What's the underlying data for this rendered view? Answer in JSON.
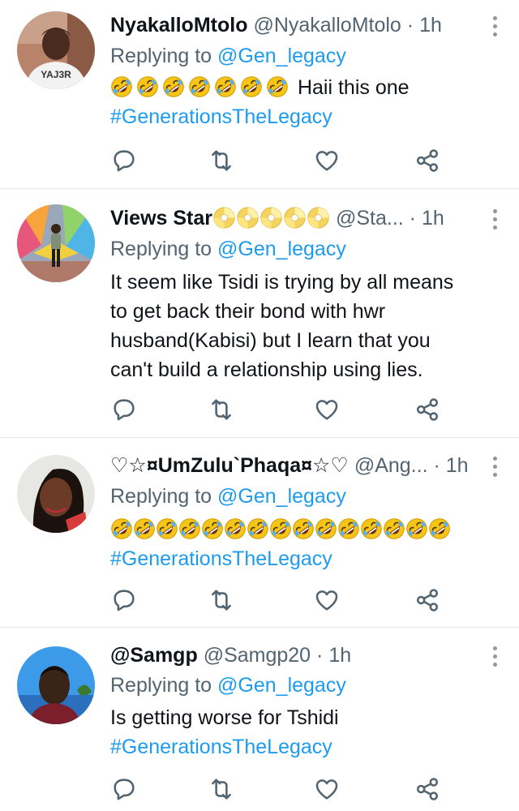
{
  "tweets": [
    {
      "name": "NyakalloMtolo",
      "handle": "@NyakalloMtolo",
      "dot": "·",
      "time": "1h",
      "replying_prefix": "Replying to",
      "replying_to": "@Gen_legacy",
      "text": "Haii this one",
      "hashtag": "#GenerationsTheLegacy",
      "emoji_count": 7,
      "avatar_shirt_text": "YAJ3R"
    },
    {
      "name": "Views Star",
      "handle": "@Sta...",
      "dot": "·",
      "time": "1h",
      "replying_prefix": "Replying to",
      "replying_to": "@Gen_legacy",
      "lines": [
        "It seem like Tsidi is trying by all means",
        "to get back their bond with hwr",
        "husband(Kabisi) but I learn that you",
        "can't build a relationship using lies."
      ],
      "name_emoji_count": 5
    },
    {
      "name": "♡☆¤UmZulu`Phaqa¤☆♡",
      "handle": "@Ang...",
      "dot": "·",
      "time": "1h",
      "replying_prefix": "Replying to",
      "replying_to": "@Gen_legacy",
      "hashtag": "#GenerationsTheLegacy",
      "emoji_count": 15
    },
    {
      "name": "@Samgp",
      "handle": "@Samgp20",
      "dot": "·",
      "time": "1h",
      "replying_prefix": "Replying to",
      "replying_to": "@Gen_legacy",
      "text": "Is getting worse for Tshidi",
      "hashtag": "#GenerationsTheLegacy"
    }
  ],
  "icons": {
    "reply": "reply-icon",
    "retweet": "retweet-icon",
    "like": "heart-icon",
    "share": "share-icon",
    "more": "more-options-icon",
    "emoji": "rolling-on-floor-laughing-emoji",
    "coin": "dvd-disc-emoji"
  },
  "colors": {
    "link": "#1d9bf0",
    "secondary_text": "#536471",
    "primary_text": "#0f1419",
    "icon": "#536471",
    "divider": "#e4e8eb"
  }
}
